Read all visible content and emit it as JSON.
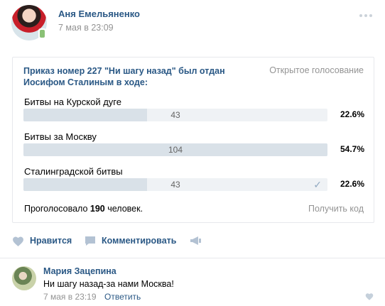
{
  "post": {
    "author": "Аня Емельяненко",
    "date": "7 мая в 23:09"
  },
  "poll": {
    "question": "Приказ номер 227 \"Ни шагу назад\" был отдан Иосифом Сталиным в ходе:",
    "type_label": "Открытое голосование",
    "options": [
      {
        "label": "Битвы на Курской дуге",
        "votes": "43",
        "percent": "22.6%",
        "share": 0.406,
        "checked": false
      },
      {
        "label": "Битвы за Москву",
        "votes": "104",
        "percent": "54.7%",
        "share": 1.0,
        "checked": false
      },
      {
        "label": "Сталинградской битвы",
        "votes": "43",
        "percent": "22.6%",
        "share": 0.406,
        "checked": true
      }
    ],
    "total_prefix": "Проголосовало ",
    "total_count": "190",
    "total_suffix": " человек.",
    "get_code_label": "Получить код"
  },
  "actions": {
    "like_label": "Нравится",
    "comment_label": "Комментировать"
  },
  "comment": {
    "author": "Мария Зацепина",
    "text": "Ни шагу назад-за нами Москва!",
    "date": "7 мая в 23:19",
    "reply_label": "Ответить"
  },
  "colors": {
    "link": "#2a5885",
    "muted": "#939393",
    "bar_bg": "#eff2f5",
    "bar_fill": "#d9e1e8"
  },
  "icons": {
    "more": "more-dots-icon",
    "like": "heart-icon",
    "comment": "comment-bubble-icon",
    "share": "megaphone-icon",
    "checked": "checkmark-icon"
  }
}
